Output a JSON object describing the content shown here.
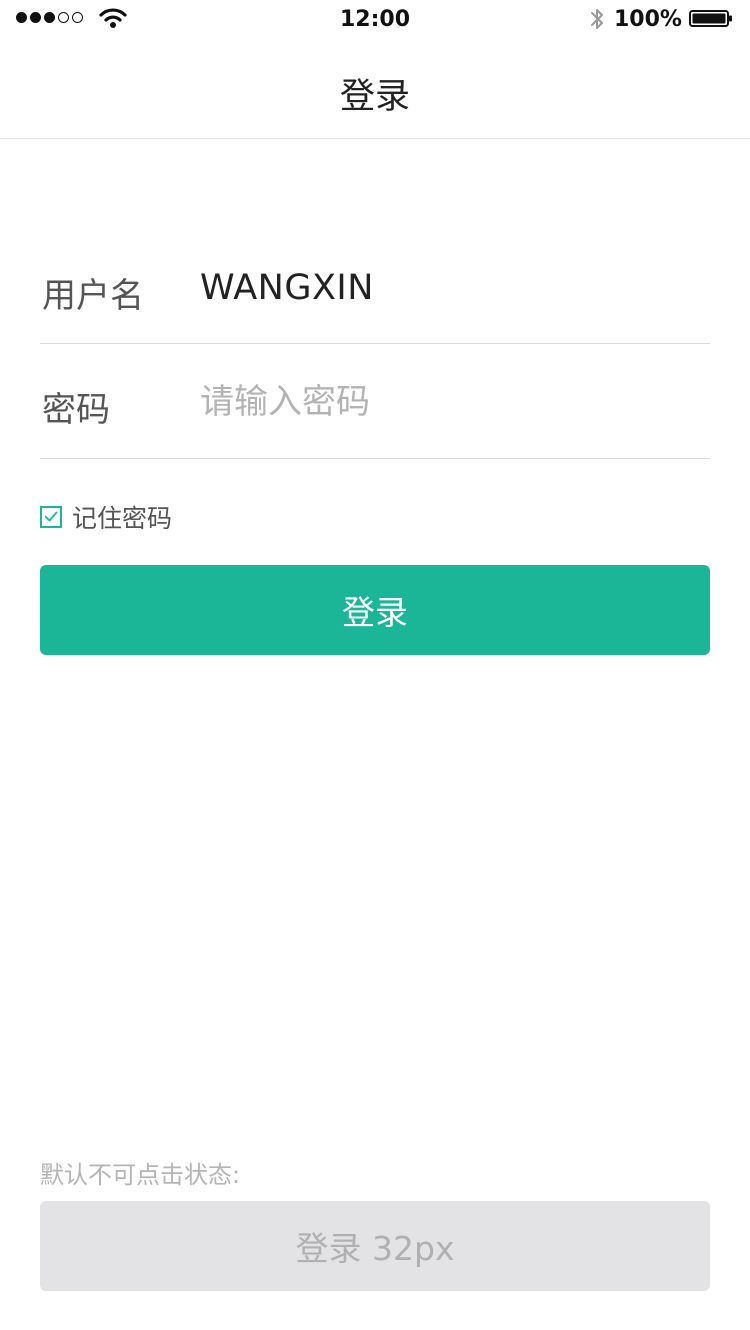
{
  "status_bar": {
    "time": "12:00",
    "battery_percent": "100%",
    "signal_strength": 3,
    "signal_max": 5,
    "icons": [
      "signal-dots-icon",
      "wifi-icon",
      "bluetooth-icon",
      "battery-icon"
    ]
  },
  "nav": {
    "title": "登录"
  },
  "form": {
    "username_label": "用户名",
    "username_value": "WANGXIN",
    "password_label": "密码",
    "password_placeholder": "请输入密码",
    "remember_label": "记住密码",
    "remember_checked": true
  },
  "login_button": {
    "label": "登录"
  },
  "disabled_section": {
    "caption": "默认不可点击状态:",
    "button_label": "登录 32px"
  },
  "colors": {
    "accent": "#1bb697",
    "disabled_bg": "#e3e3e5",
    "disabled_text": "#b0b0b0",
    "placeholder": "#b3b3b3"
  }
}
